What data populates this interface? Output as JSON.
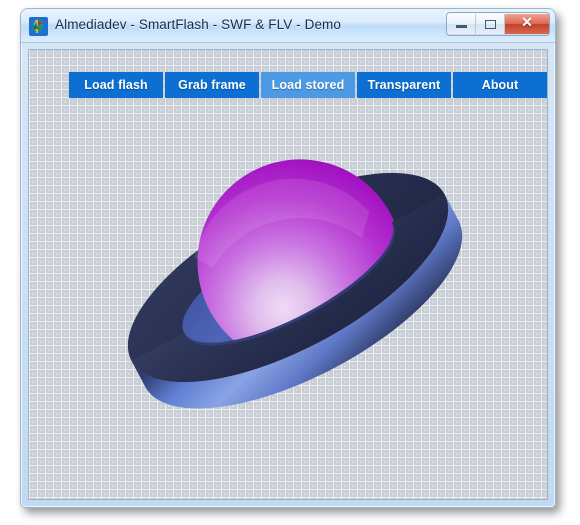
{
  "window": {
    "title": "Almediadev - SmartFlash - SWF & FLV - Demo",
    "icon": "app-logo-icon",
    "controls": {
      "minimize_label": "",
      "maximize_label": "",
      "close_label": "✕"
    }
  },
  "toolbar": {
    "buttons": [
      {
        "label": "Load flash",
        "state": "normal"
      },
      {
        "label": "Grab frame",
        "state": "normal"
      },
      {
        "label": "Load stored",
        "state": "hover"
      },
      {
        "label": "Transparent",
        "state": "normal"
      },
      {
        "label": "About",
        "state": "normal"
      }
    ],
    "button_color": "#0d6fd1",
    "button_hover_color": "#4d9ae4",
    "button_text_color": "#ffffff"
  },
  "stage": {
    "graphic_name": "ringed-sphere-graphic",
    "description": "Purple sphere encircled by a tilted blue torus ring",
    "colors": {
      "sphere_highlight": "#e5c8ee",
      "sphere_mid": "#c468e0",
      "sphere_deep": "#a716c6",
      "ring_top_dark": "#2a3150",
      "ring_band_light": "#7f9ade",
      "ring_band_mid": "#5772c4",
      "ring_band_dark": "#232a4a",
      "ring_inner_blue": "#4a63b4",
      "background": "#c9ced6"
    }
  },
  "theme": {
    "titlebar_start": "#e9f3fc",
    "titlebar_end": "#dceefd",
    "frame_border": "#9bb7cf",
    "close_button": "#c4402c"
  }
}
